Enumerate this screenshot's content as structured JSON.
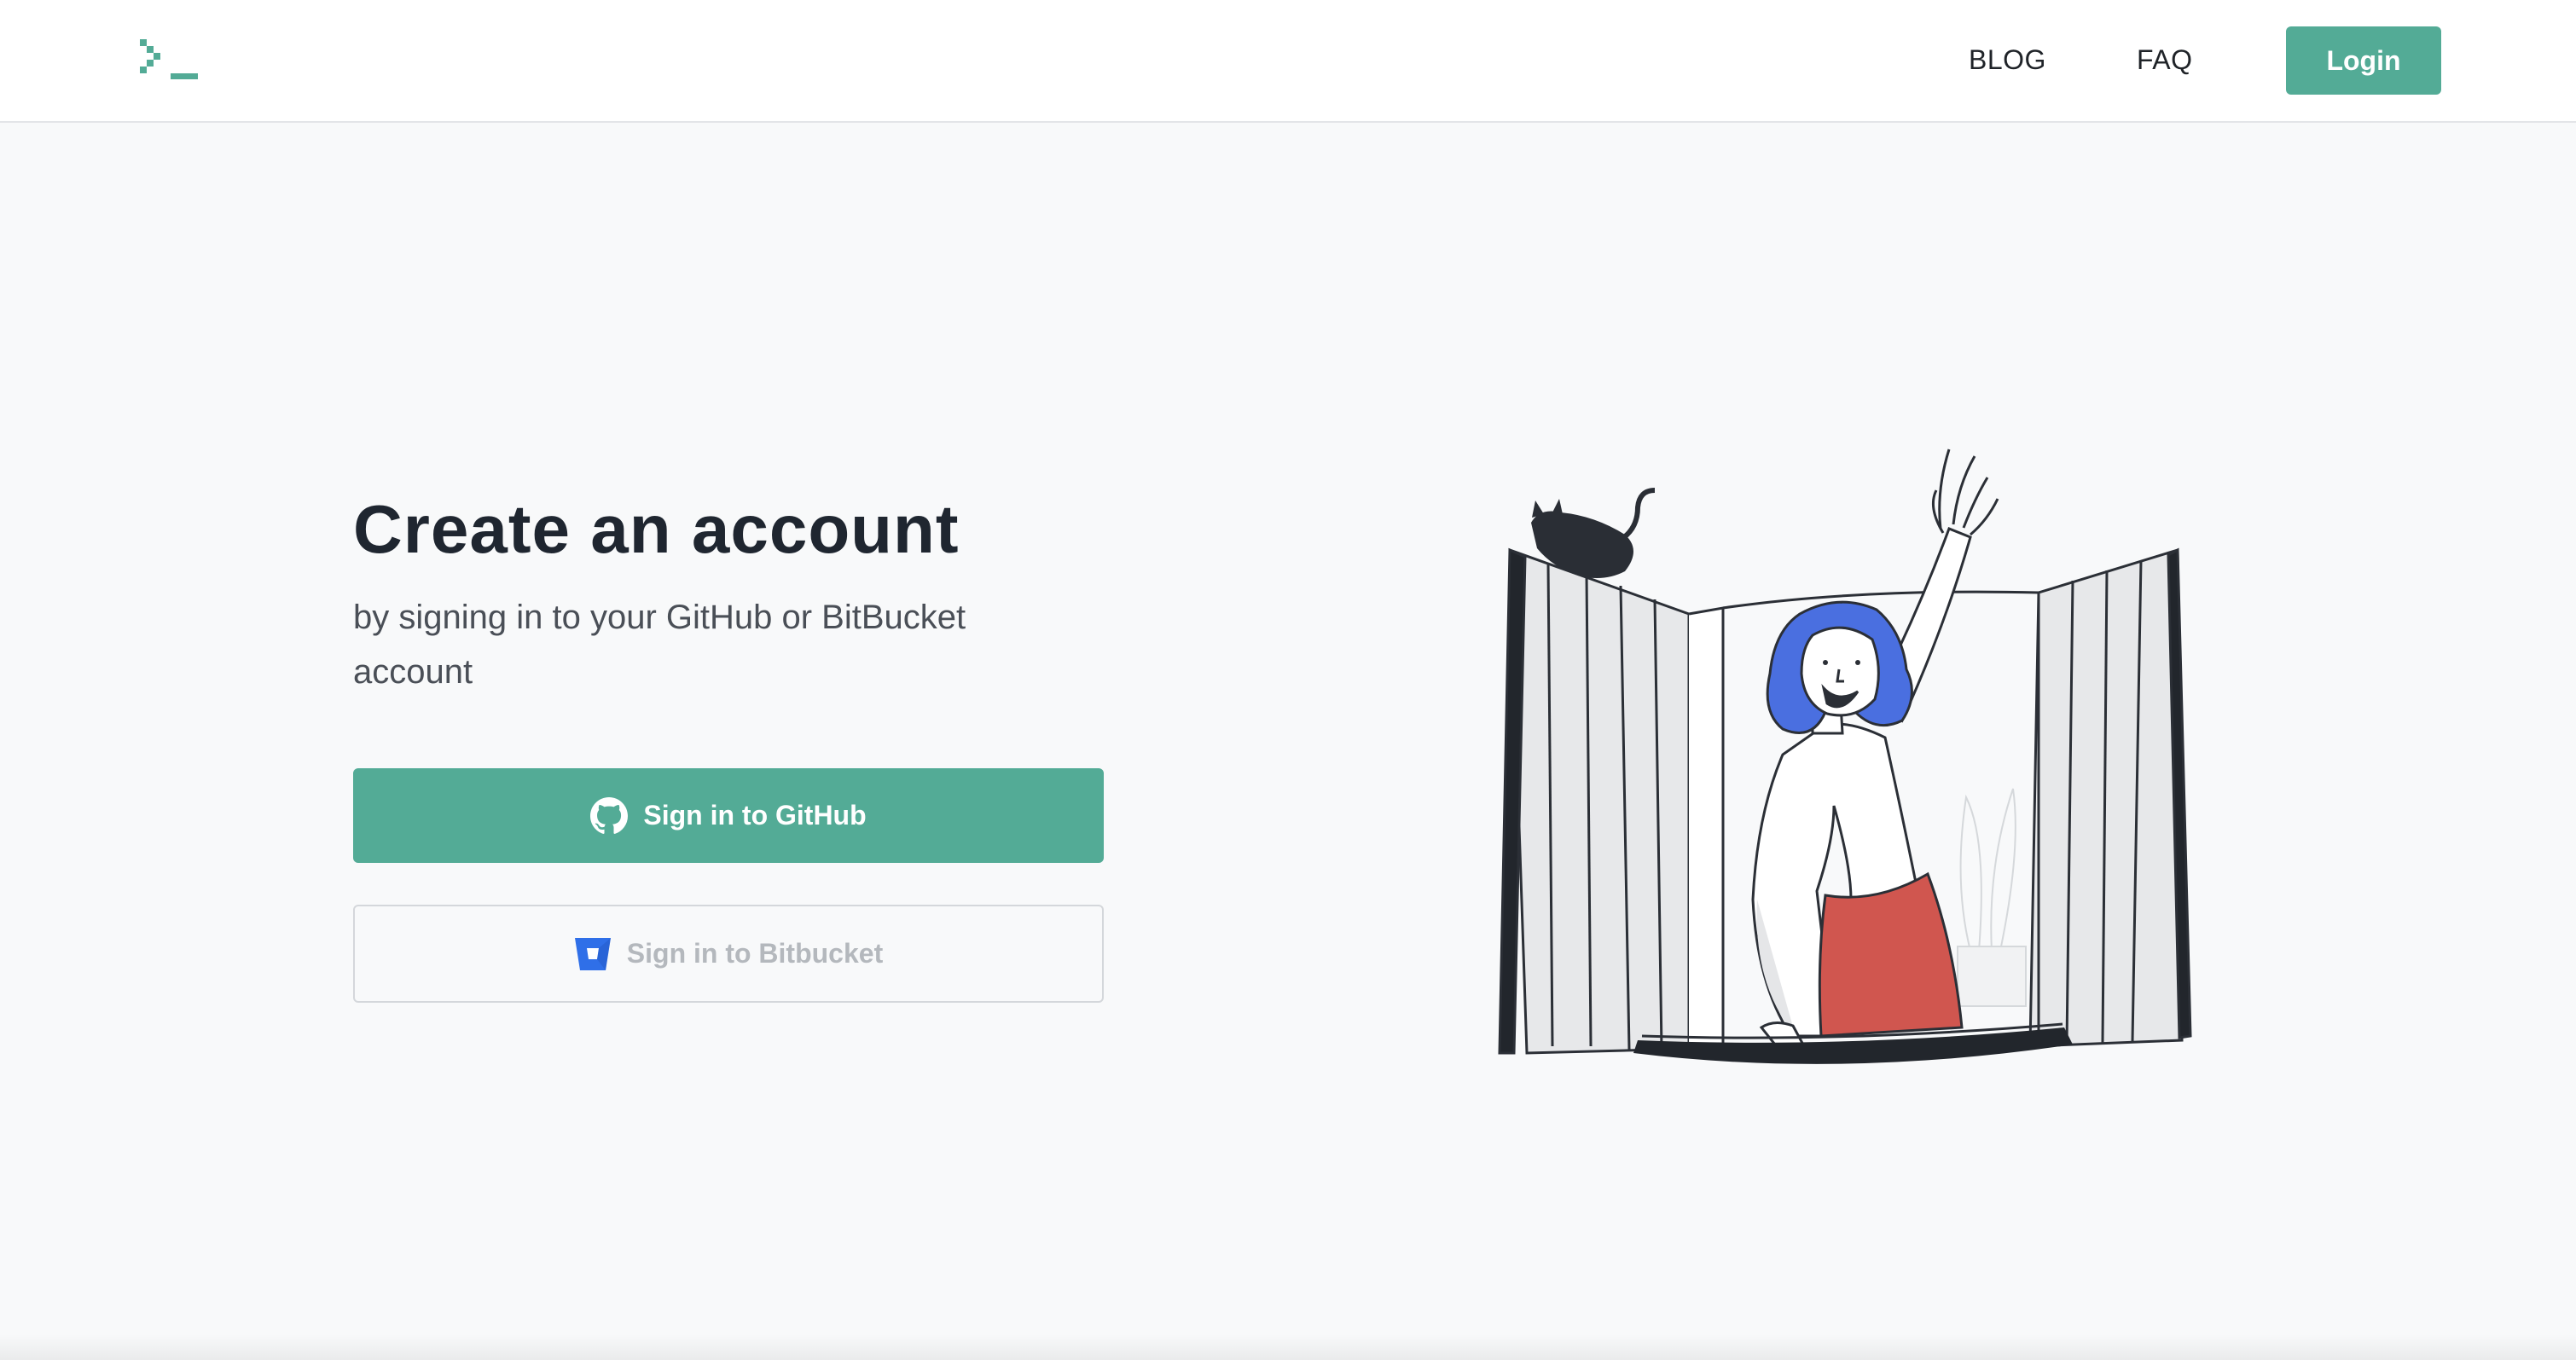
{
  "header": {
    "logo_icon": "terminal-prompt-icon",
    "nav": [
      {
        "label": "BLOG"
      },
      {
        "label": "FAQ"
      }
    ],
    "login_label": "Login"
  },
  "main": {
    "title": "Create an account",
    "subtitle": "by signing in to your GitHub or BitBucket account",
    "github_button": {
      "label": "Sign in to GitHub",
      "icon": "github-icon"
    },
    "bitbucket_button": {
      "label": "Sign in to Bitbucket",
      "icon": "bitbucket-icon"
    },
    "illustration": "woman-waving-from-window-with-cat"
  },
  "colors": {
    "accent": "#53ab96",
    "background": "#f8f9fa",
    "bitbucket_blue": "#2f6fe8",
    "hair_blue": "#4a6fe0",
    "skirt_red": "#d0564f"
  }
}
